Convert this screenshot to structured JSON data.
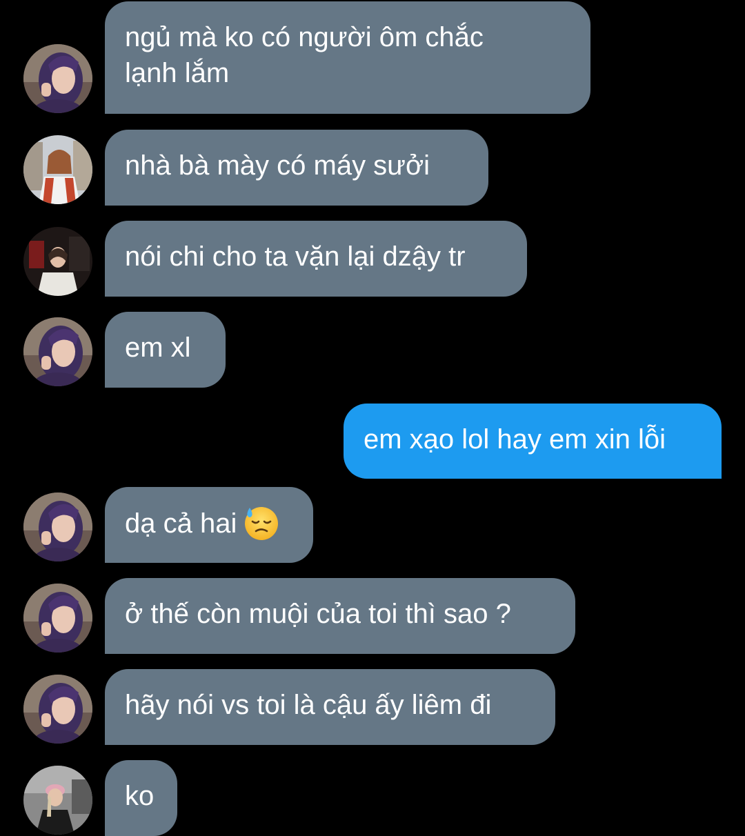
{
  "thread": {
    "messages": [
      {
        "sender": "incoming",
        "avatar": "avatar-purple-hair",
        "text": "ngủ mà ko có người ôm chắc\nlạnh lắm"
      },
      {
        "sender": "incoming",
        "avatar": "avatar-street",
        "text": "nhà bà mày có máy sưởi"
      },
      {
        "sender": "incoming",
        "avatar": "avatar-dark-room",
        "text": "nói chi cho ta vặn lại dzậy tr"
      },
      {
        "sender": "incoming",
        "avatar": "avatar-purple-hair",
        "text": "em xl"
      },
      {
        "sender": "outgoing",
        "text": "em xạo lol hay em xin lỗi"
      },
      {
        "sender": "incoming",
        "avatar": "avatar-purple-hair",
        "text": "dạ cả hai",
        "emoji": "downcast-face-with-sweat-icon"
      },
      {
        "sender": "incoming",
        "avatar": "avatar-purple-hair",
        "text": "ở thế còn muội của toi thì sao ?"
      },
      {
        "sender": "incoming",
        "avatar": "avatar-purple-hair",
        "text": "hãy nói vs toi là cậu ấy liêm đi"
      },
      {
        "sender": "incoming",
        "avatar": "avatar-black-outfit",
        "text": "ko"
      }
    ]
  },
  "colors": {
    "background": "#000000",
    "incoming_bubble": "#657786",
    "outgoing_bubble": "#1d9bf0",
    "text": "#ffffff"
  }
}
